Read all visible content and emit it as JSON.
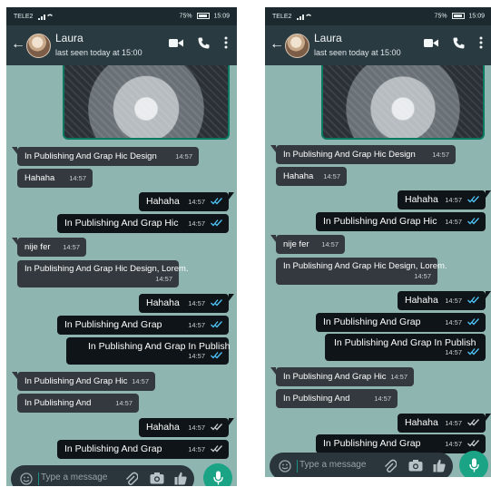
{
  "status": {
    "carrier": "TELE2",
    "battery": "75%",
    "time": "15:09"
  },
  "contact": {
    "name": "Laura",
    "last_seen": "last seen today at 15:00"
  },
  "input": {
    "placeholder": "Type a message"
  },
  "colors": {
    "header": "#2a3a41",
    "wallpaper": "#8fb5b1",
    "incoming": "#33393e",
    "outgoing": "#0e1418",
    "accent": "#1ba385",
    "read_tick": "#4fc3f7",
    "sent_tick": "#c9d0d3"
  },
  "icons": [
    "back-arrow-icon",
    "video-call-icon",
    "phone-icon",
    "menu-dots-icon",
    "emoji-icon",
    "attach-icon",
    "camera-icon",
    "thumb-up-icon",
    "mic-icon"
  ],
  "left": {
    "messages": [
      {
        "dir": "in",
        "text": "In Publishing And Grap Hic Design",
        "time": "14:57"
      },
      {
        "dir": "in",
        "text": "Hahaha",
        "time": "14:57"
      },
      {
        "dir": "out",
        "text": "Hahaha",
        "time": "14:57",
        "ticks": "read"
      },
      {
        "dir": "out",
        "text": "In Publishing And Grap Hic",
        "time": "14:57",
        "ticks": "read"
      },
      {
        "dir": "in",
        "text": "nije fer",
        "time": "14:57"
      },
      {
        "dir": "in",
        "text": "In Publishing And Grap Hic Design, Lorem.",
        "time": "14:57"
      },
      {
        "dir": "out",
        "text": "Hahaha",
        "time": "14:57",
        "ticks": "read"
      },
      {
        "dir": "out",
        "text": "In Publishing And Grap",
        "time": "14:57",
        "ticks": "read"
      },
      {
        "dir": "out",
        "text": "In Publishing And Grap In Publish",
        "time": "14:57",
        "ticks": "read"
      },
      {
        "dir": "in",
        "text": "In Publishing And Grap Hic",
        "time": "14:57"
      },
      {
        "dir": "in",
        "text": "In Publishing And",
        "time": "14:57"
      },
      {
        "dir": "out",
        "text": "Hahaha",
        "time": "14:57",
        "ticks": "sent"
      },
      {
        "dir": "out",
        "text": "In Publishing And Grap",
        "time": "14:57",
        "ticks": "sent"
      }
    ]
  },
  "right": {
    "messages": [
      {
        "dir": "in",
        "text": "In Publishing And Grap Hic Design",
        "time": "14:57"
      },
      {
        "dir": "in",
        "text": "Hahaha",
        "time": "14:57"
      },
      {
        "dir": "out",
        "text": "Hahaha",
        "time": "14:57",
        "ticks": "read"
      },
      {
        "dir": "out",
        "text": "In Publishing And Grap Hic",
        "time": "14:57",
        "ticks": "read"
      },
      {
        "dir": "in",
        "text": "nije fer",
        "time": "14:57"
      },
      {
        "dir": "in",
        "text": "In Publishing And Grap Hic Design, Lorem.",
        "time": "14:57"
      },
      {
        "dir": "out",
        "text": "Hahaha",
        "time": "14:57",
        "ticks": "read"
      },
      {
        "dir": "out",
        "text": "In Publishing And Grap",
        "time": "14:57",
        "ticks": "read"
      },
      {
        "dir": "out",
        "text": "In Publishing And Grap In Publish",
        "time": "14:57",
        "ticks": "read"
      },
      {
        "dir": "in",
        "text": "In Publishing And Grap Hic",
        "time": "14:57"
      },
      {
        "dir": "in",
        "text": "In Publishing And",
        "time": "14:57"
      },
      {
        "dir": "out",
        "text": "Hahaha",
        "time": "14:57",
        "ticks": "sent"
      },
      {
        "dir": "out",
        "text": "In Publishing And Grap",
        "time": "14:57",
        "ticks": "sent"
      }
    ]
  }
}
